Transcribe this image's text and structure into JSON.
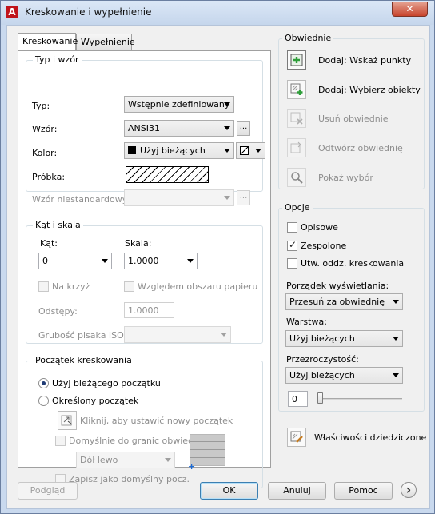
{
  "window": {
    "title": "Kreskowanie i wypełnienie",
    "close_glyph": "✕",
    "app_icon": "A"
  },
  "tabs": {
    "hatch": "Kreskowanie",
    "gradient": "Wypełnienie"
  },
  "type_pattern": {
    "group_title": "Typ i wzór",
    "type_label": "Typ:",
    "type_value": "Wstępnie zdefiniowany",
    "pattern_label": "Wzór:",
    "pattern_value": "ANSI31",
    "pattern_browse": "...",
    "color_label": "Kolor:",
    "color_value": "Użyj bieżących",
    "sample_label": "Próbka:",
    "custom_label": "Wzór niestandardowy:",
    "custom_browse": "..."
  },
  "angle_scale": {
    "group_title": "Kąt i skala",
    "angle_label": "Kąt:",
    "angle_value": "0",
    "scale_label": "Skala:",
    "scale_value": "1.0000",
    "double_label": "Na krzyż",
    "paper_label": "Względem obszaru papieru",
    "spacing_label": "Odstępy:",
    "spacing_value": "1.0000",
    "pen_label": "Grubość pisaka ISO:"
  },
  "origin": {
    "group_title": "Początek kreskowania",
    "current_label": "Użyj bieżącego początku",
    "specified_label": "Określony początek",
    "click_label": "Kliknij, aby ustawić nowy początek",
    "default_extents_label": "Domyślnie do granic obwiedni",
    "position_value": "Dół lewo",
    "store_label": "Zapisz jako domyślny pocz."
  },
  "boundaries": {
    "group_title": "Obwiednie",
    "add_pick": "Dodaj: Wskaż punkty",
    "add_select": "Dodaj: Wybierz obiekty",
    "remove": "Usuń obwiednie",
    "recreate": "Odtwórz obwiednię",
    "view": "Pokaż wybór"
  },
  "options": {
    "group_title": "Opcje",
    "annotative": "Opisowe",
    "annotative_checked": false,
    "associative": "Zespolone",
    "associative_checked": true,
    "separate": "Utw. oddz. kreskowania",
    "separate_checked": false,
    "draw_order_label": "Porządek wyświetlania:",
    "draw_order_value": "Przesuń za obwiednię",
    "layer_label": "Warstwa:",
    "layer_value": "Użyj bieżących",
    "transparency_label": "Przezroczystość:",
    "transparency_value": "Użyj bieżących",
    "transparency_number": "0",
    "transparency_level": 0
  },
  "inherit": {
    "label": "Właściwości dziedziczone"
  },
  "footer": {
    "preview": "Podgląd",
    "ok": "OK",
    "cancel": "Anuluj",
    "help": "Pomoc",
    "more_glyph": "›"
  },
  "colors": {
    "close": "#c7432b",
    "accent": "#3c7fb1",
    "add_icon": "#2e9e3a"
  }
}
